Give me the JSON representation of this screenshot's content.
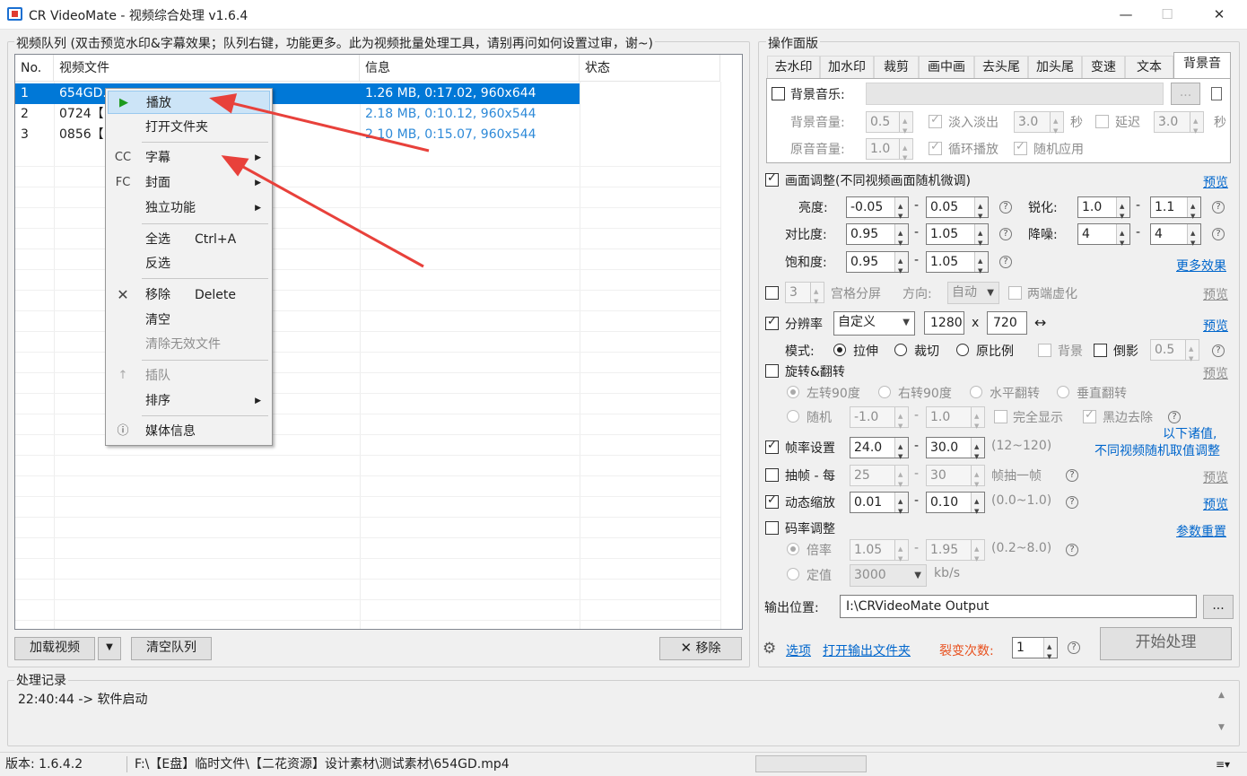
{
  "window": {
    "title": "CR VideoMate - 视频综合处理 v1.6.4",
    "minimize": "—",
    "maximize": "☐",
    "close": "✕"
  },
  "queue": {
    "group_label": "视频队列 (双击预览水印&字幕效果；队列右键，功能更多。此为视频批量处理工具，请别再问如何设置过审，谢~)",
    "columns": [
      "No.",
      "视频文件",
      "信息",
      "状态"
    ],
    "rows": [
      {
        "no": "1",
        "file": "654GD.",
        "info": "1.26 MB, 0:17.02, 960x644",
        "status": ""
      },
      {
        "no": "2",
        "file": "0724【",
        "info": "2.18 MB, 0:10.12, 960x544",
        "status": ""
      },
      {
        "no": "3",
        "file": "0856【",
        "info": "2.10 MB, 0:15.07, 960x544",
        "status": ""
      }
    ],
    "load_button": "加载视频",
    "clear_button": "清空队列",
    "remove_button": "移除"
  },
  "context_menu": {
    "play": "播放",
    "open_folder": "打开文件夹",
    "subtitle_icon": "CC",
    "subtitle": "字幕",
    "cover_icon": "FC",
    "cover": "封面",
    "standalone": "独立功能",
    "select_all": "全选",
    "select_all_shortcut": "Ctrl+A",
    "invert": "反选",
    "remove": "移除",
    "remove_shortcut": "Delete",
    "clear": "清空",
    "clear_invalid": "清除无效文件",
    "insert": "插队",
    "sort": "排序",
    "media_info": "媒体信息"
  },
  "panel": {
    "group_label": "操作面版",
    "tabs": [
      "去水印",
      "加水印",
      "裁剪",
      "画中画",
      "去头尾",
      "加头尾",
      "变速",
      "文本",
      "背景音"
    ],
    "bgm": {
      "label": "背景音乐:",
      "browse": "...",
      "bg_volume_label": "背景音量:",
      "bg_volume": "0.5",
      "fade_label": "淡入淡出",
      "fade_value": "3.0",
      "sec": "秒",
      "delay_label": "延迟",
      "delay_value": "3.0",
      "orig_volume_label": "原音音量:",
      "orig_volume": "1.0",
      "loop_label": "循环播放",
      "random_label": "随机应用"
    },
    "picture": {
      "label": "画面调整(不同视频画面随机微调)",
      "preview": "预览",
      "brightness_label": "亮度:",
      "brightness_min": "-0.05",
      "brightness_max": "0.05",
      "sharpen_label": "锐化:",
      "sharpen_min": "1.0",
      "sharpen_max": "1.1",
      "contrast_label": "对比度:",
      "contrast_min": "0.95",
      "contrast_max": "1.05",
      "denoise_label": "降噪:",
      "denoise_min": "4",
      "denoise_max": "4",
      "saturation_label": "饱和度:",
      "saturation_min": "0.95",
      "saturation_max": "1.05",
      "more_effects": "更多效果",
      "dash": "-"
    },
    "grid": {
      "value": "3",
      "label": "宫格分屏",
      "direction_label": "方向:",
      "direction": "自动",
      "blur_label": "两端虚化",
      "preview": "预览"
    },
    "resolution": {
      "label": "分辨率",
      "mode": "自定义",
      "width": "1280",
      "x": "x",
      "height": "720",
      "swap": "↔",
      "preview": "预览",
      "mode_label": "模式:",
      "stretch": "拉伸",
      "crop": "裁切",
      "ratio": "原比例",
      "bg": "背景",
      "shadow": "倒影",
      "shadow_value": "0.5"
    },
    "rotate": {
      "label": "旋转&翻转",
      "preview": "预览",
      "left90": "左转90度",
      "right90": "右转90度",
      "hflip": "水平翻转",
      "vflip": "垂直翻转",
      "random": "随机",
      "random_min": "-1.0",
      "random_max": "1.0",
      "full_show": "完全显示",
      "remove_black": "黑边去除",
      "note1": "以下诸值,",
      "note2": "不同视频随机取值调整"
    },
    "framerate": {
      "label": "帧率设置",
      "min": "24.0",
      "max": "30.0",
      "range": "(12~120)"
    },
    "drop": {
      "label": "抽帧 - 每",
      "min": "25",
      "max": "30",
      "suffix": "帧抽一帧",
      "preview": "预览"
    },
    "zoom": {
      "label": "动态缩放",
      "min": "0.01",
      "max": "0.10",
      "range": "(0.0~1.0)",
      "preview": "预览"
    },
    "bitrate": {
      "label": "码率调整",
      "reset": "参数重置",
      "ratio_label": "倍率",
      "ratio_min": "1.05",
      "ratio_max": "1.95",
      "ratio_range": "(0.2~8.0)",
      "fixed_label": "定值",
      "fixed_value": "3000",
      "unit": "kb/s"
    },
    "output": {
      "label": "输出位置:",
      "path": "I:\\CRVideoMate Output",
      "browse": "..."
    },
    "bottom": {
      "options": "选项",
      "open_output": "打开输出文件夹",
      "fission_label": "裂变次数:",
      "fission_value": "1",
      "start": "开始处理"
    }
  },
  "log": {
    "group_label": "处理记录",
    "lines": [
      "22:40:44 -> 软件启动"
    ]
  },
  "status": {
    "version": "版本: 1.6.4.2",
    "path": "F:\\【E盘】临时文件\\【二花资源】设计素材\\测试素材\\654GD.mp4"
  },
  "colors": {
    "selection": "#0078d7",
    "info_text": "#2e8ad8",
    "link": "#0066cc",
    "fission_label": "#e8501d",
    "arrow": "#e8413b",
    "play_icon": "#1d9a1d"
  }
}
